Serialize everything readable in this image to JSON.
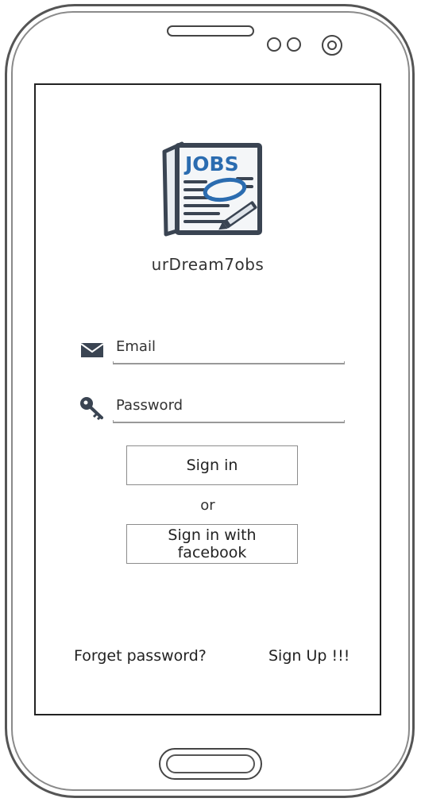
{
  "app": {
    "logo_text": "JOBS",
    "name": "urDream7obs"
  },
  "login_form": {
    "email": {
      "placeholder": "Email",
      "icon": "envelope-icon"
    },
    "password": {
      "placeholder": "Password",
      "icon": "key-icon"
    },
    "sign_in_label": "Sign in",
    "or_label": "or",
    "facebook_label": "Sign in with facebook"
  },
  "footer": {
    "forgot_label": "Forget password?",
    "sign_up_label": "Sign Up !!!"
  },
  "colors": {
    "logo_blue": "#2b6cb0",
    "logo_dark": "#3a4452",
    "outline": "#444444"
  }
}
